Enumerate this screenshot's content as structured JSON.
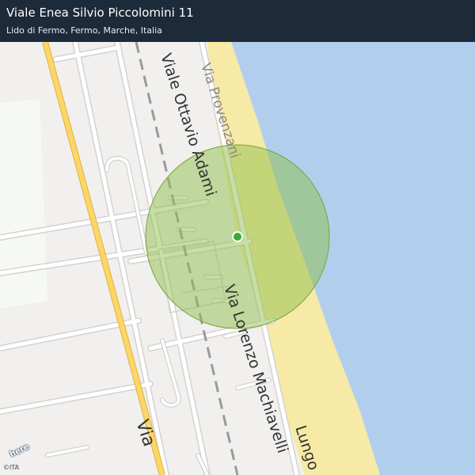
{
  "header": {
    "title": "Viale Enea Silvio Piccolomini 11",
    "subtitle": "Lido di Fermo, Fermo, Marche, Italia"
  },
  "map": {
    "streets": {
      "viale_ottavio_adami": "Viale Ottavio Adami",
      "via_provenzani": "Via Provenzani",
      "via_lorenzo_machiavelli": "Via Lorenzo Machiavelli",
      "lungomare": "Lungo",
      "via_main": "Via"
    },
    "colors": {
      "sea": "#b1cfed",
      "beach": "#f7eaa6",
      "land": "#f1f0ee",
      "main_road": "#fcd667",
      "accuracy_circle": "#8fbd4b",
      "location_dot": "#3aa83a"
    }
  },
  "attribution": {
    "logo_text": "here",
    "copyright": "©ITA"
  }
}
